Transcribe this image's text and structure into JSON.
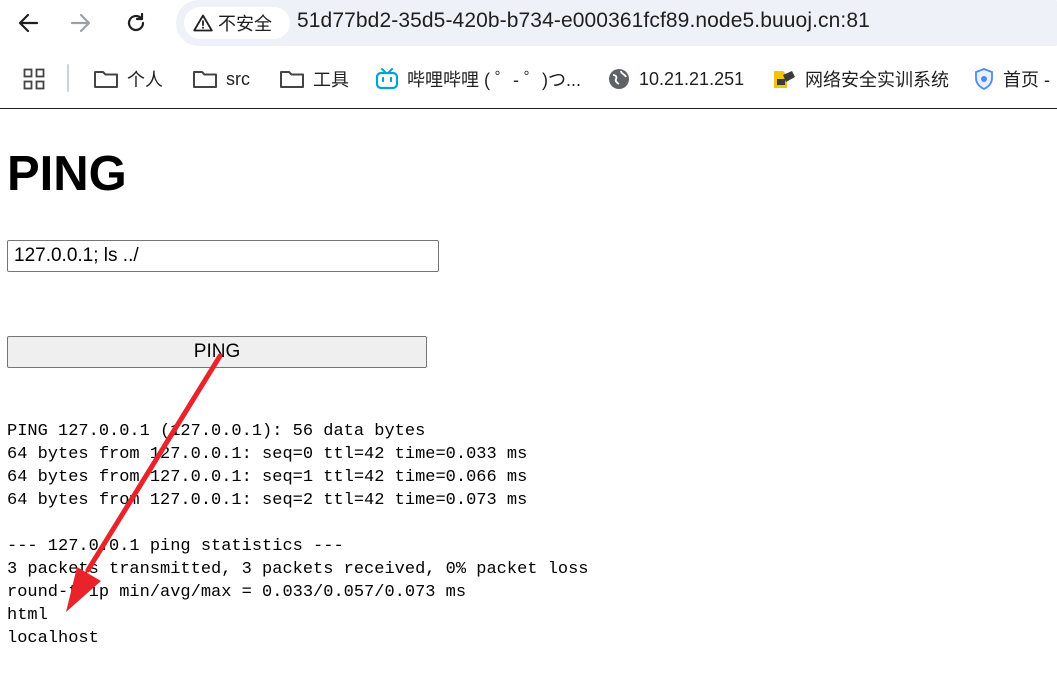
{
  "browser": {
    "security_label": "不安全",
    "url": "51d77bd2-35d5-420b-b734-e000361fcf89.node5.buuoj.cn:81"
  },
  "bookmarks": [
    {
      "label": "个人",
      "icon": "folder-icon"
    },
    {
      "label": "src",
      "icon": "folder-icon"
    },
    {
      "label": "工具",
      "icon": "folder-icon"
    },
    {
      "label": "哔哩哔哩 ( ゜- ゜)つ...",
      "icon": "bilibili-icon"
    },
    {
      "label": "10.21.21.251",
      "icon": "globe-icon"
    },
    {
      "label": "网络安全实训系统",
      "icon": "site-icon"
    },
    {
      "label": "首页 -",
      "icon": "shield-icon"
    }
  ],
  "page": {
    "title": "PING",
    "input_value": "127.0.0.1; ls ../",
    "button_label": "PING",
    "output_lines": [
      "PING 127.0.0.1 (127.0.0.1): 56 data bytes",
      "64 bytes from 127.0.0.1: seq=0 ttl=42 time=0.033 ms",
      "64 bytes from 127.0.0.1: seq=1 ttl=42 time=0.066 ms",
      "64 bytes from 127.0.0.1: seq=2 ttl=42 time=0.073 ms",
      "",
      "--- 127.0.0.1 ping statistics ---",
      "3 packets transmitted, 3 packets received, 0% packet loss",
      "round-trip min/avg/max = 0.033/0.057/0.073 ms",
      "html",
      "localhost"
    ]
  },
  "annotation": {
    "arrow_color": "#e8232a"
  }
}
